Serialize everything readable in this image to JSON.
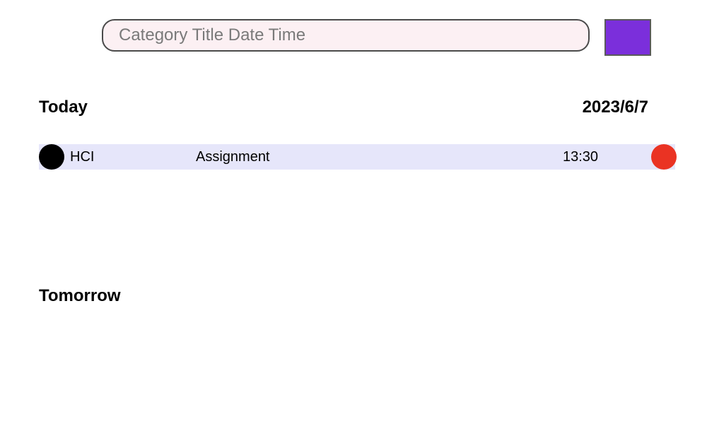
{
  "search": {
    "placeholder": "Category Title Date Time",
    "value": ""
  },
  "add_button": {
    "color": "#7b2fdb"
  },
  "today": {
    "title": "Today",
    "date": "2023/6/7",
    "tasks": [
      {
        "category": "HCI",
        "title": "Assignment",
        "time": "13:30",
        "category_color": "#000000",
        "delete_color": "#ea3323"
      }
    ]
  },
  "tomorrow": {
    "title": "Tomorrow",
    "tasks": []
  },
  "colors": {
    "search_background": "#fcf0f3",
    "task_row_background": "#e6e6fa"
  }
}
